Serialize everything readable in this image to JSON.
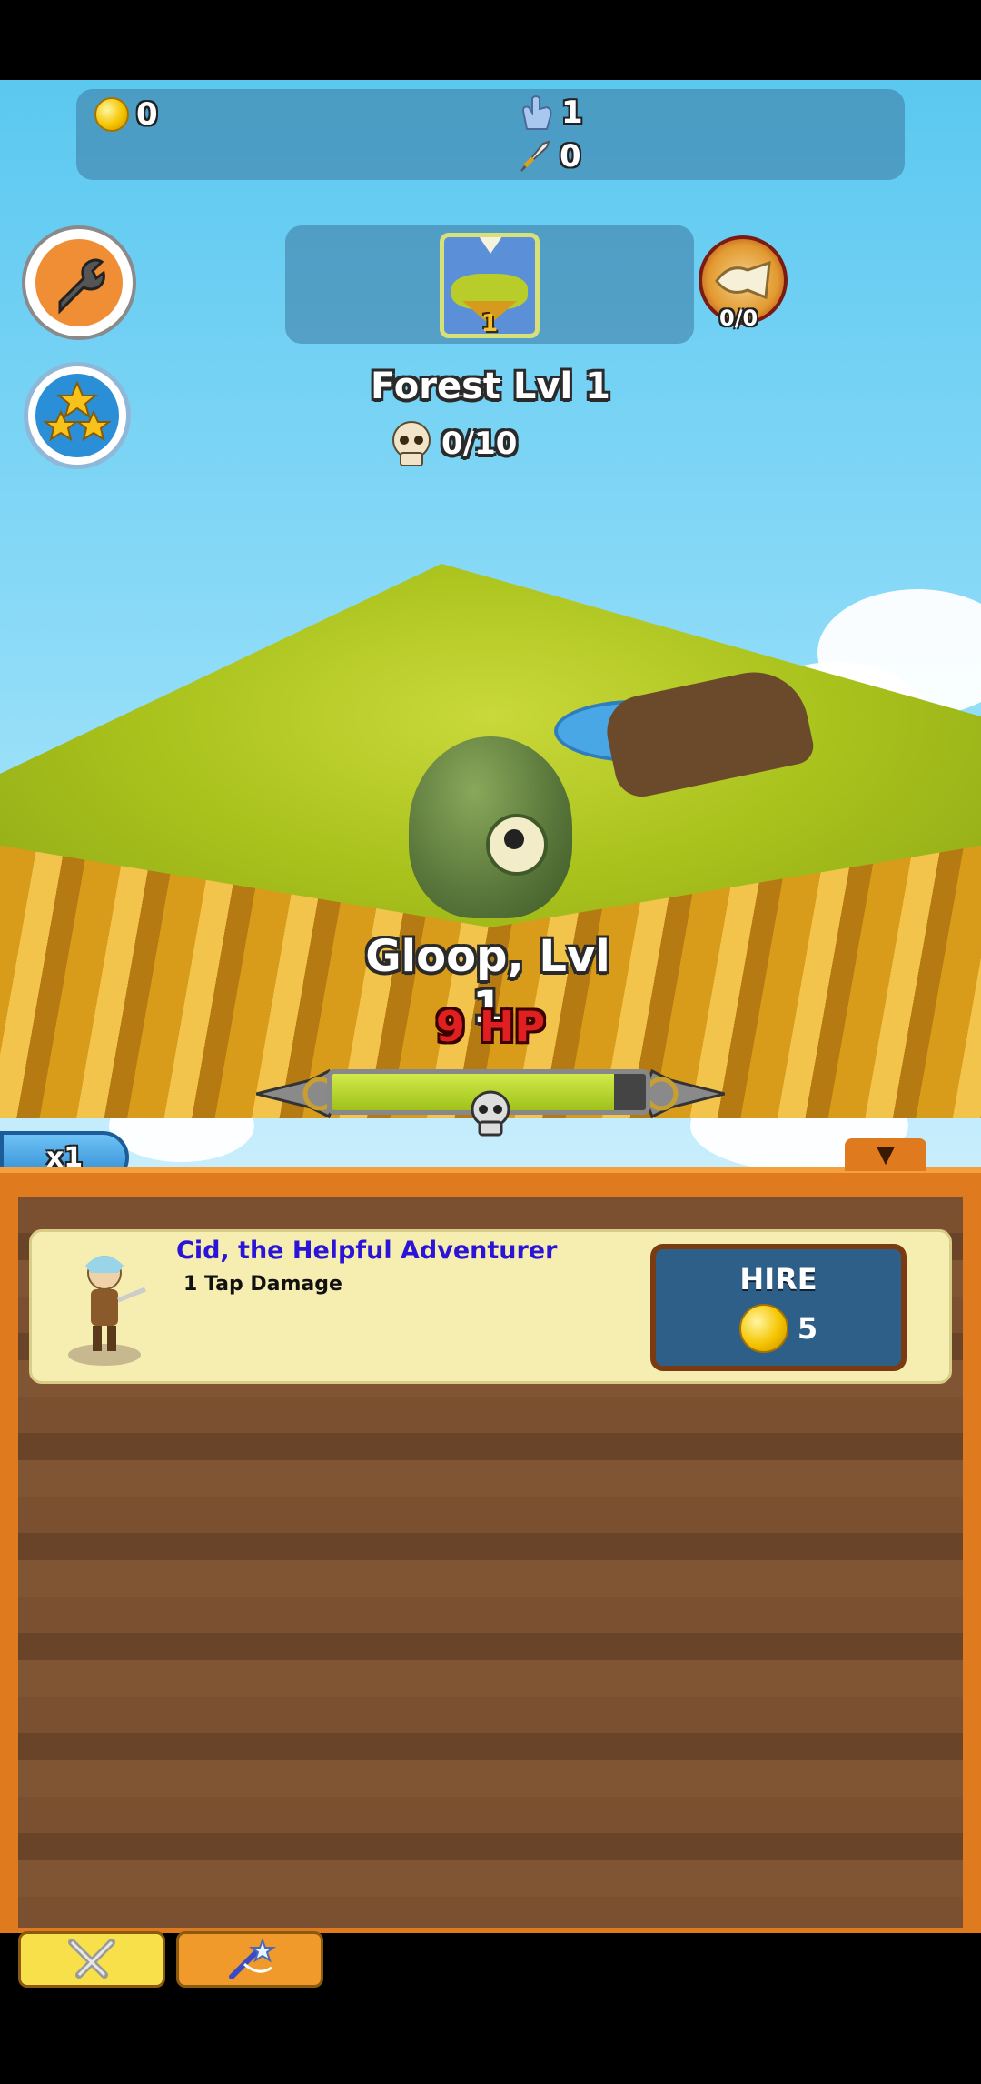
{
  "top_bar": {
    "gold": "0",
    "damage_per_tap": "1",
    "dps": "0"
  },
  "zone": {
    "current_zone_number": "1",
    "boss_progress": "0/0",
    "title": "Forest Lvl 1",
    "kills": "0/10"
  },
  "monster": {
    "name": "Gloop, Lvl 1",
    "hp": "9 HP",
    "hp_fraction": 0.9
  },
  "multiplier": "x1",
  "hero": {
    "name": "Cid, the Helpful Adventurer",
    "stat": "1 Tap Damage",
    "hire_label": "HIRE",
    "cost": "5"
  },
  "icons": {
    "settings": "wrench-icon",
    "achievements": "stars-icon",
    "boss": "horn-icon",
    "tab_heroes": "swords-icon",
    "tab_skills": "magic-wand-icon",
    "kills": "skull-icon"
  },
  "colors": {
    "accent_orange": "#e07a1e",
    "hire_blue": "#2e5f88",
    "hero_name": "#2a14d8"
  }
}
